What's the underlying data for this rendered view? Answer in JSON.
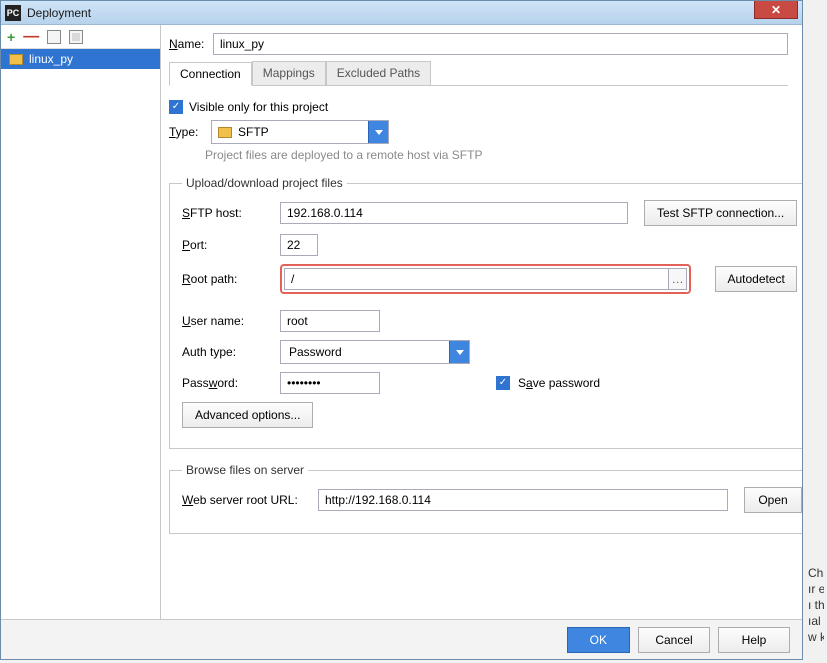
{
  "window": {
    "title": "Deployment"
  },
  "sidebar": {
    "items": [
      {
        "label": "linux_py"
      }
    ]
  },
  "form": {
    "name_label": "Name:",
    "name_value": "linux_py",
    "tabs": [
      {
        "label": "Connection",
        "active": true
      },
      {
        "label": "Mappings",
        "active": false
      },
      {
        "label": "Excluded Paths",
        "active": false
      }
    ],
    "visible_only_label": "Visible only for this project",
    "visible_only_checked": true,
    "type_label": "Type:",
    "type_value": "SFTP",
    "type_hint": "Project files are deployed to a remote host via SFTP",
    "upload_legend": "Upload/download project files",
    "sftp_host_label": "SFTP host:",
    "sftp_host_value": "192.168.0.114",
    "test_btn": "Test SFTP connection...",
    "port_label": "Port:",
    "port_value": "22",
    "root_label": "Root path:",
    "root_value": "/",
    "autodetect_btn": "Autodetect",
    "user_label": "User name:",
    "user_value": "root",
    "auth_label": "Auth type:",
    "auth_value": "Password",
    "password_label": "Password:",
    "password_value": "••••••••",
    "save_pw_label": "Save password",
    "save_pw_checked": true,
    "advanced_btn": "Advanced options...",
    "browse_legend": "Browse files on server",
    "web_label": "Web server root URL:",
    "web_value": "http://192.168.0.114",
    "open_btn": "Open"
  },
  "footer": {
    "ok": "OK",
    "cancel": "Cancel",
    "help": "Help"
  },
  "bg_fragments": [
    "Cha",
    "ır e",
    "ı th",
    "ıal",
    "w ki"
  ]
}
